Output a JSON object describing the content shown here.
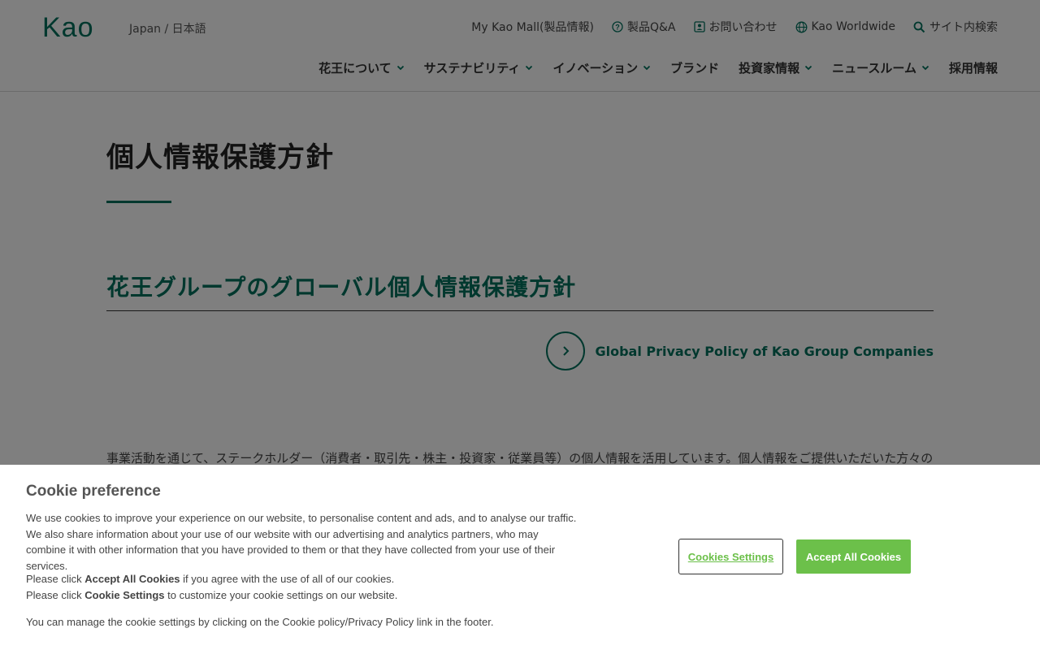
{
  "header": {
    "logo_text": "Kao",
    "region": "Japan / 日本語",
    "utility": [
      {
        "label": "My Kao Mall(製品情報)",
        "icon": ""
      },
      {
        "label": "製品Q&A",
        "icon": "question-circle-icon"
      },
      {
        "label": "お問い合わせ",
        "icon": "contact-icon"
      },
      {
        "label": "Kao Worldwide",
        "icon": "globe-icon"
      },
      {
        "label": "サイト内検索",
        "icon": "search-icon"
      }
    ],
    "nav": [
      {
        "label": "花王について",
        "has_dropdown": true
      },
      {
        "label": "サステナビリティ",
        "has_dropdown": true
      },
      {
        "label": "イノベーション",
        "has_dropdown": true
      },
      {
        "label": "ブランド",
        "has_dropdown": false
      },
      {
        "label": "投資家情報",
        "has_dropdown": true
      },
      {
        "label": "ニュースルーム",
        "has_dropdown": true
      },
      {
        "label": "採用情報",
        "has_dropdown": false
      }
    ]
  },
  "main": {
    "page_title": "個人情報保護方針",
    "section_title": "花王グループのグローバル個人情報保護方針",
    "global_policy_link": "Global Privacy Policy of Kao Group Companies",
    "body_text": "事業活動を通じて、ステークホルダー（消費者・取引先・株主・投資家・従業員等）の個人情報を活用しています。個人情報をご提供いただいた方々の"
  },
  "cookie_banner": {
    "title": "Cookie preference",
    "description": "We use cookies to improve your experience on our website, to personalise content and ads, and to analyse our traffic. We also share information about your use of our website with our advertising and analytics partners, who may combine it with other information that you have provided to them or that they have collected from your use of their services.",
    "accept_line": {
      "prefix": "Please click ",
      "bold": "Accept All Cookies",
      "suffix": " if you agree with the use of all of our cookies."
    },
    "settings_line": {
      "prefix": "Please click ",
      "bold": "Cookie Settings",
      "suffix": " to customize your cookie settings on our website."
    },
    "manage_text": "You can manage the cookie settings by clicking on the Cookie policy/Privacy Policy link in the footer.",
    "settings_button": "Cookies Settings",
    "accept_button": "Accept All Cookies"
  },
  "colors": {
    "brand_green": "#00715d",
    "cookie_green": "#6cc04a",
    "overlay": "rgba(0,0,0,0.5)"
  }
}
